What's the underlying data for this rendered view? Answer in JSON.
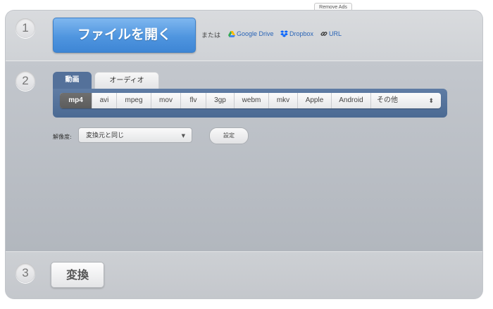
{
  "header": {
    "remove_ads": "Remove Ads"
  },
  "step1": {
    "number": "1",
    "open_button": "ファイルを開く",
    "or_text": "または",
    "sources": [
      {
        "label": "Google Drive",
        "icon": "google-drive-icon",
        "color": "#2a64b6"
      },
      {
        "label": "Dropbox",
        "icon": "dropbox-icon",
        "color": "#2a64b6"
      },
      {
        "label": "URL",
        "icon": "link-icon",
        "color": "#2a64b6"
      }
    ]
  },
  "step2": {
    "number": "2",
    "tabs": [
      {
        "label": "動画",
        "active": true
      },
      {
        "label": "オーディオ",
        "active": false
      }
    ],
    "formats": [
      "mp4",
      "avi",
      "mpeg",
      "mov",
      "flv",
      "3gp",
      "webm",
      "mkv",
      "Apple",
      "Android",
      "その他"
    ],
    "selected_format": "mp4",
    "resolution_label": "解像度:",
    "resolution_value": "変換元と同じ",
    "settings_button": "設定"
  },
  "step3": {
    "number": "3",
    "convert_button": "変換"
  },
  "colors": {
    "accent_blue": "#4f95df",
    "tab_bar": "#54719a",
    "selected_format_bg": "#636363"
  }
}
